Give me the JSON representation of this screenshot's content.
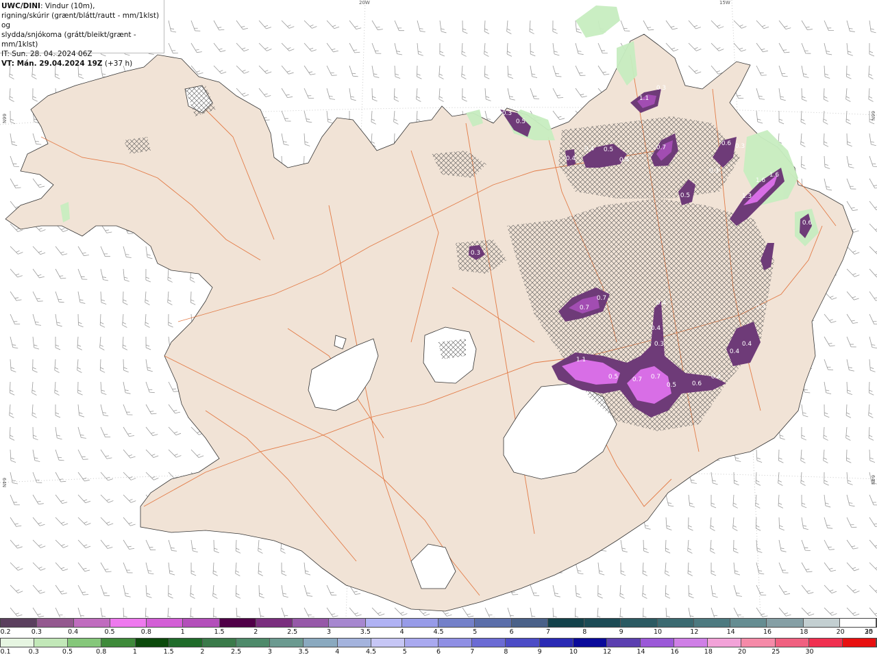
{
  "header": {
    "title": "UWC/DINI",
    "description_line1": ": Vindur (10m),",
    "description_line2": "rigning/skúrir (grænt/blátt/rautt - mm/1klst) og",
    "description_line3": "slydda/snjókoma (grátt/bleikt/grænt - mm/1klst)",
    "init_time": "IT: Sun. 28. 04. 2024 06Z",
    "valid_label": "VT: Mán. 29.04.2024 19Z",
    "valid_offset": " (+37 h)"
  },
  "grid_labels": {
    "lon_20w": "20W",
    "lon_15w": "15W",
    "lat_66n_left": "66N",
    "lat_66n_right": "66N",
    "lat_64n_left": "64N",
    "lat_64n_right": "64N"
  },
  "colors": {
    "sea": "#ffffff",
    "land": "#f1e3d6",
    "coast": "#333333",
    "roads": "#e0692e",
    "glacier": "#ffffff",
    "barbs": "#9a9a9a",
    "hatch": "#444444",
    "purple_dark": "#6e3b78",
    "purple_mid": "#a24db2",
    "purple_light": "#d86ee6",
    "green_light": "#c7edc0"
  },
  "precip_labels": [
    {
      "text": "0.3"
    },
    {
      "text": "0.5"
    },
    {
      "text": "1.1"
    },
    {
      "text": "0.3"
    },
    {
      "text": "0.4"
    },
    {
      "text": "0.4"
    },
    {
      "text": "0.5"
    },
    {
      "text": "0.4"
    },
    {
      "text": "0.7"
    },
    {
      "text": "0.6"
    },
    {
      "text": "0.3"
    },
    {
      "text": "0.5"
    },
    {
      "text": "1.6"
    },
    {
      "text": "1.6"
    },
    {
      "text": "1.3"
    },
    {
      "text": "0.3"
    },
    {
      "text": "0.3"
    },
    {
      "text": "0.6"
    },
    {
      "text": "0.7"
    },
    {
      "text": "0.7"
    },
    {
      "text": "0.4"
    },
    {
      "text": "0.4"
    },
    {
      "text": "0.3"
    },
    {
      "text": "0.4"
    },
    {
      "text": "0.3"
    },
    {
      "text": "0.4"
    },
    {
      "text": "1.1"
    },
    {
      "text": "0.5"
    },
    {
      "text": "0.7"
    },
    {
      "text": "0.7"
    },
    {
      "text": "0.5"
    },
    {
      "text": "0.6"
    },
    {
      "text": "0.4"
    }
  ],
  "legend_snow": {
    "colors": [
      "#5b3f5e",
      "#94588f",
      "#c06cbf",
      "#ee79ee",
      "#d35fd6",
      "#b34fba",
      "#500048",
      "#7a2e7e",
      "#9658a8",
      "#a687cf",
      "#b0b2f4",
      "#979be8",
      "#7380c9",
      "#5b6eaa",
      "#4a6189",
      "#13424b",
      "#1c4b55",
      "#2b5a62",
      "#3b6a71",
      "#4d7a80",
      "#658d92",
      "#859fa5",
      "#c3cfd1",
      "#ffffff"
    ],
    "labels": [
      "0.2",
      "0.3",
      "0.4",
      "0.5",
      "0.8",
      "1",
      "1.5",
      "2",
      "2.5",
      "3",
      "3.5",
      "4",
      "4.5",
      "5",
      "6",
      "7",
      "8",
      "9",
      "10",
      "12",
      "14",
      "16",
      "18",
      "20",
      "25",
      "30"
    ]
  },
  "legend_rain": {
    "colors": [
      "#e6f5e1",
      "#c2e8b8",
      "#85c77a",
      "#3e8a3a",
      "#0c4a0c",
      "#1f6b2a",
      "#3a7a4a",
      "#4e8a6a",
      "#6b9a90",
      "#8aa9bf",
      "#a4b3dd",
      "#c6c6f5",
      "#a9a9ef",
      "#8f8fe4",
      "#6b6bd4",
      "#4c4cc6",
      "#2a2ab4",
      "#0a0a9a",
      "#5b3fb0",
      "#9b59d8",
      "#cf7fe6",
      "#f2a2d8",
      "#f58aa8",
      "#f06080",
      "#f03050",
      "#e81010"
    ],
    "labels": [
      "0.1",
      "0.3",
      "0.5",
      "0.8",
      "1",
      "1.5",
      "2",
      "2.5",
      "3",
      "3.5",
      "4",
      "4.5",
      "5",
      "6",
      "7",
      "8",
      "9",
      "10",
      "12",
      "14",
      "16",
      "18",
      "20",
      "25",
      "30"
    ]
  }
}
